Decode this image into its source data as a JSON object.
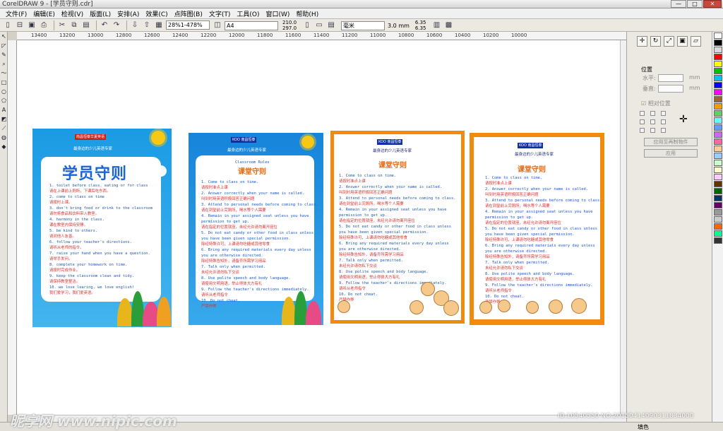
{
  "window": {
    "title": "CorelDRAW 9 - [学员守则.cdr]"
  },
  "menu": [
    "文件(F)",
    "编辑(E)",
    "检视(V)",
    "版面(L)",
    "安排(A)",
    "效果(C)",
    "点阵图(B)",
    "文字(T)",
    "工具(O)",
    "窗口(W)",
    "帮助(H)"
  ],
  "toolbar": {
    "zoom": "28%1-478%",
    "paper": "A4",
    "width": "210.0",
    "height": "297.0",
    "units": "毫米",
    "nudge": "3.0 mm",
    "duplicate_x": "6.35",
    "duplicate_y": "6.35"
  },
  "ruler": [
    "13400",
    "13200",
    "13000",
    "12800",
    "12600",
    "12400",
    "12200",
    "12000",
    "11800",
    "11600",
    "11400",
    "11200",
    "11000",
    "10800",
    "10600",
    "10400",
    "10200",
    "10000"
  ],
  "posters": [
    {
      "brand": "南昌恒泰华夏英语",
      "tagline": "最身边的少儿英语专家",
      "title": "学员守则",
      "lines": [
        {
          "lang": "en",
          "text": "1. toilet before class. eating or for class"
        },
        {
          "lang": "zh",
          "text": "请在上课前上厕所，下课后吃东西。"
        },
        {
          "lang": "en",
          "text": "2. come to class on time"
        },
        {
          "lang": "zh",
          "text": "请按时上课。"
        },
        {
          "lang": "en",
          "text": "3. don't bring food or drink to the classroom"
        },
        {
          "lang": "zh",
          "text": "请勿将食品和饮料带入教室。"
        },
        {
          "lang": "en",
          "text": "4. harmony in the class."
        },
        {
          "lang": "zh",
          "text": "课在教室内保持安静。"
        },
        {
          "lang": "en",
          "text": "5. be kind to others."
        },
        {
          "lang": "zh",
          "text": "请对他人友善。"
        },
        {
          "lang": "en",
          "text": "6. follow your teacher's directions."
        },
        {
          "lang": "zh",
          "text": "请听从老师的指令。"
        },
        {
          "lang": "en",
          "text": "7. raise your hand when you have a question."
        },
        {
          "lang": "zh",
          "text": "请举手发问。"
        },
        {
          "lang": "en",
          "text": "8. complete your homework on time."
        },
        {
          "lang": "zh",
          "text": "请按时完成作业。"
        },
        {
          "lang": "en",
          "text": "9. keep the classroom clean and tidy."
        },
        {
          "lang": "zh",
          "text": "请保持教室整洁。"
        },
        {
          "lang": "en",
          "text": "10. we love learing, we love english!"
        },
        {
          "lang": "zh",
          "text": "我们爱学习，我们爱英语。"
        }
      ]
    },
    {
      "brand": "KOO 南昌恒泰",
      "tagline": "最身边的少儿英语专家",
      "title": "课堂守则",
      "label": "Classroom Rules",
      "lines": [
        {
          "lang": "en",
          "text": "1. Come to class on time."
        },
        {
          "lang": "zh",
          "text": "请按时准点上课"
        },
        {
          "lang": "en",
          "text": "2. Answer correctly when your name is called."
        },
        {
          "lang": "zh",
          "text": "叫到时用英语积极回答正确问题"
        },
        {
          "lang": "en",
          "text": "3. Attend to personal needs before coming to class."
        },
        {
          "lang": "zh",
          "text": "请在到堂前上完厕所，喝水等个人需要"
        },
        {
          "lang": "en",
          "text": "4. Remain in your assigned seat unless you have"
        },
        {
          "lang": "en",
          "text": "permission to get up."
        },
        {
          "lang": "zh",
          "text": "请在指定的位置就座，未经允许请勿离开座位"
        },
        {
          "lang": "en",
          "text": "5. Do not eat candy or other food in class unless"
        },
        {
          "lang": "en",
          "text": "you have been given special permission."
        },
        {
          "lang": "zh",
          "text": "除经特殊许可，上课请勿吃糖或其他零食"
        },
        {
          "lang": "en",
          "text": "6. Bring any required materials every day unless"
        },
        {
          "lang": "en",
          "text": "you are otherwise directed."
        },
        {
          "lang": "zh",
          "text": "除经特殊告知外，请备齐所需学习用品"
        },
        {
          "lang": "en",
          "text": "7. Talk only when permitted."
        },
        {
          "lang": "zh",
          "text": "未经允许请勿私下交谈"
        },
        {
          "lang": "en",
          "text": "8. Use polite speech and body language."
        },
        {
          "lang": "zh",
          "text": "请使用文明用语，举止得体大方有礼"
        },
        {
          "lang": "en",
          "text": "9. Follow the teacher's directions immediately."
        },
        {
          "lang": "zh",
          "text": "请听从老师指令"
        },
        {
          "lang": "en",
          "text": "10. Do not cheat."
        },
        {
          "lang": "zh",
          "text": "严禁作弊"
        }
      ]
    }
  ],
  "docker": {
    "position_label": "位置",
    "horizontal_label": "水平:",
    "vertical_label": "垂直:",
    "unit": "mm",
    "relative_label": "相对位置",
    "apply_copy": "应用至再制物件",
    "apply": "应用"
  },
  "status": {
    "fill_label": "填色"
  },
  "watermarks": {
    "site": "昵享网 www.nipic.com",
    "id": "ID:10540550 NO:20150414090311834000"
  },
  "palette_colors": [
    "#ffffff",
    "#000000",
    "#d8d8d8",
    "#ff0000",
    "#ffff00",
    "#00c000",
    "#00c0ff",
    "#0000ff",
    "#ff00ff",
    "#996633",
    "#ff9900",
    "#66cc66",
    "#66ffff",
    "#6699ff",
    "#cc66ff",
    "#ff6699",
    "#ffcc99",
    "#99ccff",
    "#ccffcc",
    "#ffffcc",
    "#ffccff",
    "#663300",
    "#006600",
    "#003366",
    "#660066",
    "#999999",
    "#cccccc",
    "#ff6600",
    "#00ff99",
    "#333333"
  ]
}
